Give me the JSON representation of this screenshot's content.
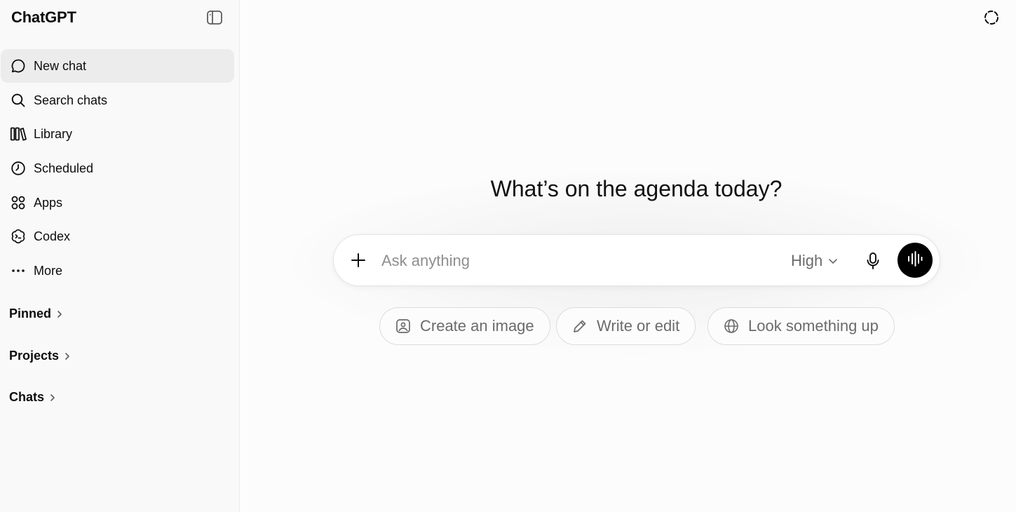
{
  "app": {
    "title": "ChatGPT"
  },
  "sidebar": {
    "toggle_icon": "sidebar-toggle-icon",
    "items": [
      {
        "label": "New chat",
        "icon": "chat-bubble-icon",
        "active": true
      },
      {
        "label": "Search chats",
        "icon": "search-icon"
      },
      {
        "label": "Library",
        "icon": "library-icon"
      },
      {
        "label": "Scheduled",
        "icon": "clock-icon"
      },
      {
        "label": "Apps",
        "icon": "apps-grid-icon"
      },
      {
        "label": "Codex",
        "icon": "codex-icon"
      },
      {
        "label": "More",
        "icon": "more-dots-icon"
      }
    ],
    "sections": [
      {
        "label": "Pinned"
      },
      {
        "label": "Projects"
      },
      {
        "label": "Chats"
      }
    ]
  },
  "main": {
    "headline": "What’s on the agenda today?",
    "composer": {
      "placeholder": "Ask anything",
      "value": "",
      "model": "High"
    },
    "suggestions": [
      {
        "label": "Create an image",
        "icon": "image-icon"
      },
      {
        "label": "Write or edit",
        "icon": "pencil-icon"
      },
      {
        "label": "Look something up",
        "icon": "globe-icon"
      }
    ],
    "top_right_icon": "temporary-chat-icon"
  },
  "colors": {
    "sidebar_bg": "#f9f9f9",
    "main_bg": "#fcfcfc",
    "active_item_bg": "#ececec",
    "voice_button_bg": "#000000",
    "muted_text": "#6b6b6b",
    "placeholder_text": "#8e8e8e"
  }
}
